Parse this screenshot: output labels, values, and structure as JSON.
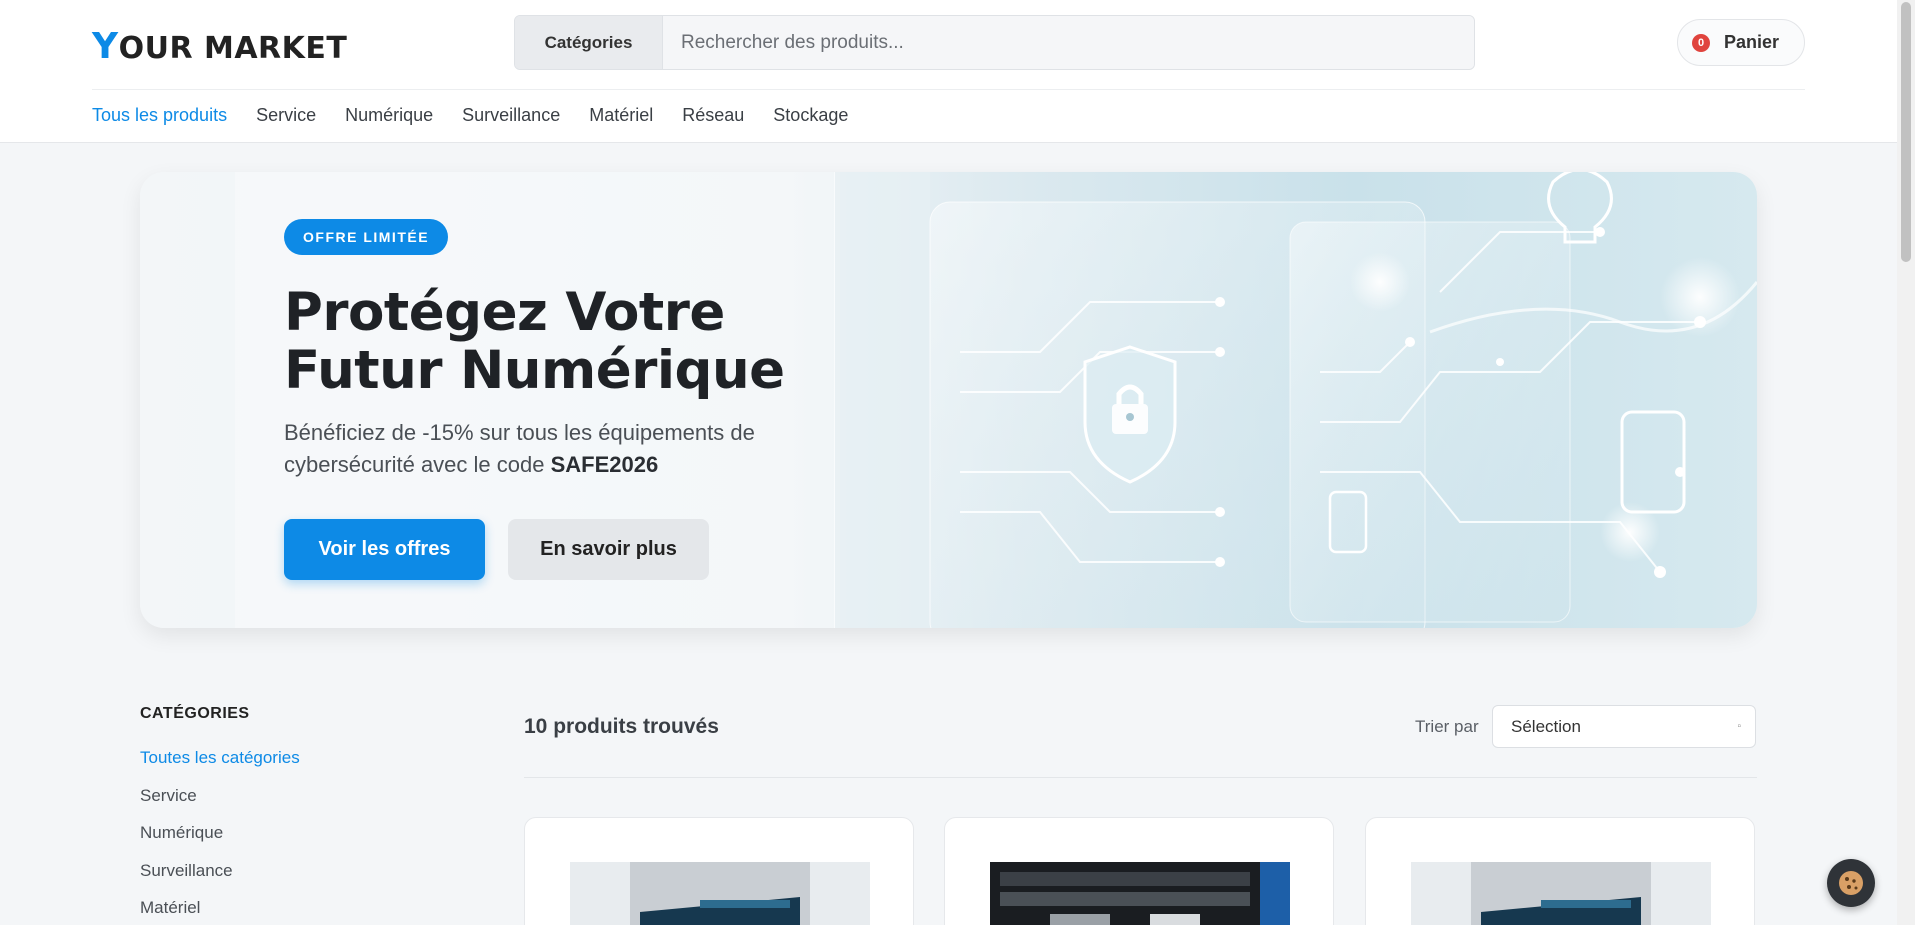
{
  "header": {
    "logo_first": "Y",
    "logo_rest": "OUR MARKET",
    "search_category": "Catégories",
    "search_placeholder": "Rechercher des produits...",
    "cart_count": "0",
    "cart_label": "Panier"
  },
  "nav": [
    "Tous les produits",
    "Service",
    "Numérique",
    "Surveillance",
    "Matériel",
    "Réseau",
    "Stockage"
  ],
  "hero": {
    "badge": "OFFRE LIMITÉE",
    "title_line1": "Protégez Votre",
    "title_line2": "Futur Numérique",
    "subtitle": "Bénéficiez de -15% sur tous les équipements de cybersécurité avec le code",
    "code": "SAFE2026",
    "primary_button": "Voir les offres",
    "secondary_button": "En savoir plus"
  },
  "sidebar": {
    "title": "CATÉGORIES",
    "items": [
      "Toutes les catégories",
      "Service",
      "Numérique",
      "Surveillance",
      "Matériel"
    ]
  },
  "products": {
    "count_text": "10 produits trouvés",
    "sort_label": "Trier par",
    "sort_value": "Sélection"
  },
  "colors": {
    "accent": "#0d8ae6",
    "badge_red": "#e0443e",
    "text_dark": "#1f2226"
  },
  "icons": {
    "cookie": "cookie-icon",
    "sort_caret": "chevron-down-icon"
  }
}
